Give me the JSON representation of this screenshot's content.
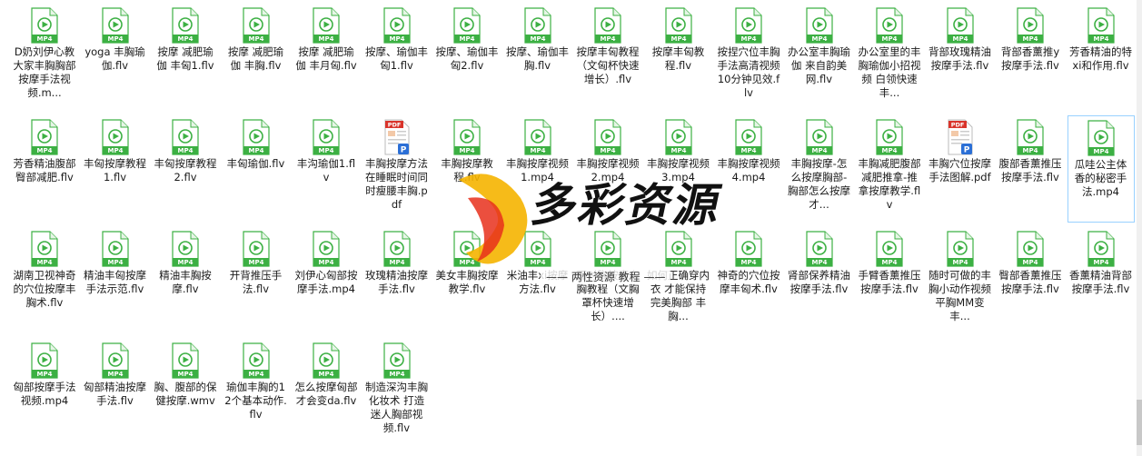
{
  "files": [
    {
      "name": "D奶刘伊心教大家丰胸胸部按摩手法视频.m...",
      "type": "mp4"
    },
    {
      "name": "yoga 丰胸瑜伽.flv",
      "type": "mp4"
    },
    {
      "name": "按摩 减肥瑜伽 丰匈1.flv",
      "type": "mp4"
    },
    {
      "name": "按摩 减肥瑜伽 丰胸.flv",
      "type": "mp4"
    },
    {
      "name": "按摩 减肥瑜伽 丰月匈.flv",
      "type": "mp4"
    },
    {
      "name": "按摩、瑜伽丰匈1.flv",
      "type": "mp4"
    },
    {
      "name": "按摩、瑜伽丰匈2.flv",
      "type": "mp4"
    },
    {
      "name": "按摩、瑜伽丰胸.flv",
      "type": "mp4"
    },
    {
      "name": "按摩丰匈教程（文匈杯快速增长）.flv",
      "type": "mp4"
    },
    {
      "name": "按摩丰匈教程.flv",
      "type": "mp4"
    },
    {
      "name": "按捏穴位丰胸手法高清视频 10分钟见效.flv",
      "type": "mp4"
    },
    {
      "name": "办公室丰胸瑜伽 来自韵美网.flv",
      "type": "mp4"
    },
    {
      "name": "办公室里的丰胸瑜伽小招视频 白领快速丰...",
      "type": "mp4"
    },
    {
      "name": "背部玫瑰精油按摩手法.flv",
      "type": "mp4"
    },
    {
      "name": "背部香薰推y按摩手法.flv",
      "type": "mp4"
    },
    {
      "name": "芳香精油的特xi和作用.flv",
      "type": "mp4"
    },
    {
      "name": "芳香精油腹部臀部减肥.flv",
      "type": "mp4"
    },
    {
      "name": "丰匈按摩教程1.flv",
      "type": "mp4"
    },
    {
      "name": "丰匈按摩教程2.flv",
      "type": "mp4"
    },
    {
      "name": "丰匈瑜伽.flv",
      "type": "mp4"
    },
    {
      "name": "丰沟瑜伽1.flv",
      "type": "mp4"
    },
    {
      "name": "丰胸按摩方法 在睡眠时间同时瘦腰丰胸.pdf",
      "type": "pdf"
    },
    {
      "name": "丰胸按摩教程.flv",
      "type": "mp4"
    },
    {
      "name": "丰胸按摩视频1.mp4",
      "type": "mp4"
    },
    {
      "name": "丰胸按摩视频2.mp4",
      "type": "mp4"
    },
    {
      "name": "丰胸按摩视频3.mp4",
      "type": "mp4"
    },
    {
      "name": "丰胸按摩视频4.mp4",
      "type": "mp4"
    },
    {
      "name": "丰胸按摩-怎么按摩胸部-胸部怎么按摩才...",
      "type": "mp4"
    },
    {
      "name": "丰胸减肥腹部减肥推拿-推拿按摩教学.flv",
      "type": "mp4"
    },
    {
      "name": "丰胸穴位按摩手法图解.pdf",
      "type": "pdf"
    },
    {
      "name": "腹部香薰推压按摩手法.flv",
      "type": "mp4"
    },
    {
      "name": "瓜哇公主体香的秘密手法.mp4",
      "type": "mp4",
      "selected": true
    },
    {
      "name": "湖南卫视神奇的穴位按摩丰胸术.flv",
      "type": "mp4"
    },
    {
      "name": "精油丰匈按摩手法示范.flv",
      "type": "mp4"
    },
    {
      "name": "精油丰胸按摩.flv",
      "type": "mp4"
    },
    {
      "name": "开背推压手法.flv",
      "type": "mp4"
    },
    {
      "name": "刘伊心匈部按摩手法.mp4",
      "type": "mp4"
    },
    {
      "name": "玫瑰精油按摩手法.flv",
      "type": "mp4"
    },
    {
      "name": "美女丰胸按摩教学.flv",
      "type": "mp4"
    },
    {
      "name": "米油丰xi按摩方法.flv",
      "type": "mp4"
    },
    {
      "name": "面对胸按摩丰胸教程（文胸罩杯快速增长）....",
      "type": "mp4"
    },
    {
      "name": "如何正确穿内衣 才能保持完美胸部 丰胸...",
      "type": "mp4"
    },
    {
      "name": "神奇的穴位按摩丰匈术.flv",
      "type": "mp4"
    },
    {
      "name": "肾部保养精油按摩手法.flv",
      "type": "mp4"
    },
    {
      "name": "手臂香薰推压按摩手法.flv",
      "type": "mp4"
    },
    {
      "name": "随时可做的丰胸小动作视频 平胸MM变丰...",
      "type": "mp4"
    },
    {
      "name": "臀部香薰推压按摩手法.flv",
      "type": "mp4"
    },
    {
      "name": "香薰精油背部按摩手法.flv",
      "type": "mp4"
    },
    {
      "name": "匈部按摩手法视频.mp4",
      "type": "mp4"
    },
    {
      "name": "匈部精油按摩手法.flv",
      "type": "mp4"
    },
    {
      "name": "胸、腹部的保健按摩.wmv",
      "type": "mp4"
    },
    {
      "name": "瑜伽丰胸的12个基本动作.flv",
      "type": "mp4"
    },
    {
      "name": "怎么按摩匈部才会变da.flv",
      "type": "mp4"
    },
    {
      "name": "制造深沟丰胸化妆术 打造迷人胸部视频.flv",
      "type": "mp4"
    }
  ],
  "icons": {
    "mp4_label": "MP4",
    "pdf_label": "PDF",
    "pdf_badge": "P",
    "mp4_color": "#3cb043",
    "pdf_color": "#d9342b",
    "pdf_badge_color": "#2b6fd6"
  },
  "watermark": {
    "title": "多彩资源",
    "subtitle": "—— 两性资源 教程 ——"
  }
}
